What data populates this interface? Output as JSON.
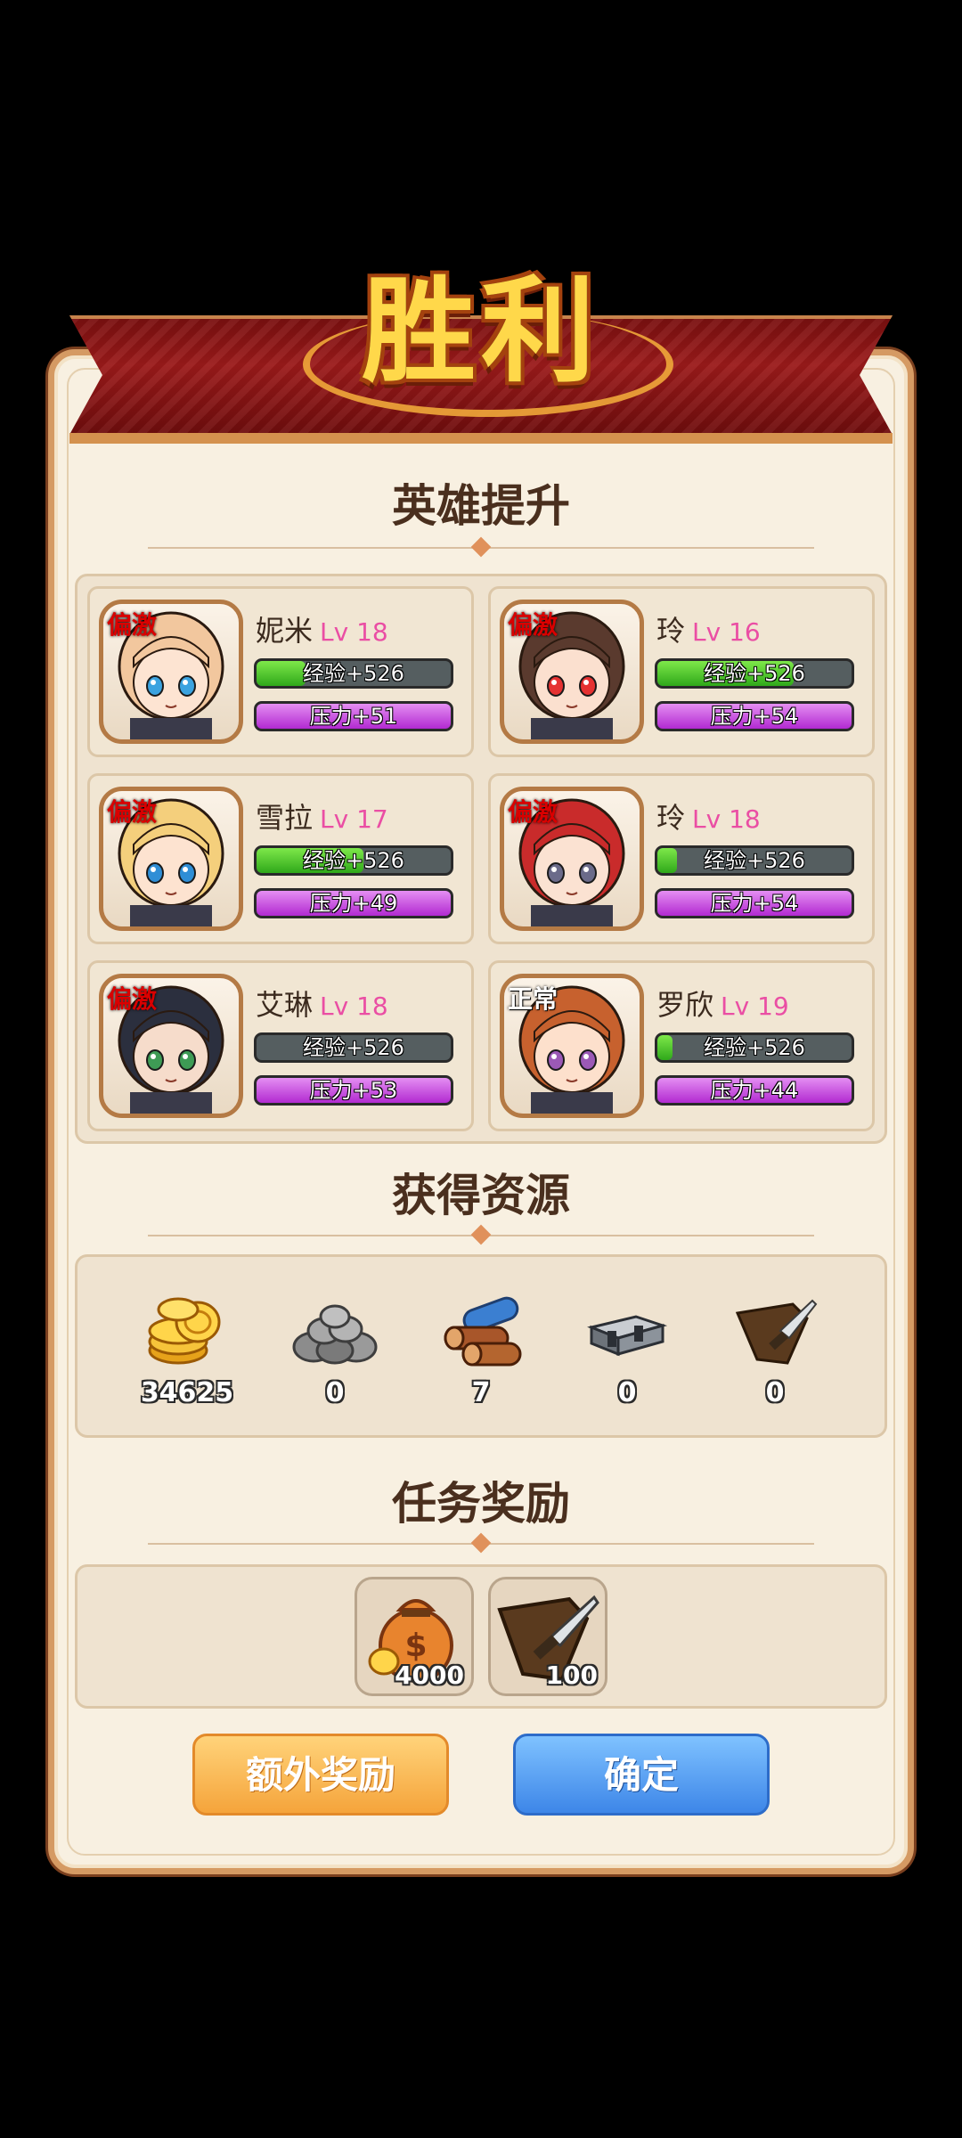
{
  "header": {
    "title": "胜利"
  },
  "heroes_section": {
    "title": "英雄提升"
  },
  "heroes": [
    {
      "tag": "偏激",
      "name": "妮米",
      "level": "Lv 18",
      "exp_text": "经验+526",
      "exp_fill": 0.25,
      "pressure_text": "压力+51",
      "hair": "#f2c79e",
      "skin": "#fde4d2",
      "accent": "#3ba3e0"
    },
    {
      "tag": "偏激",
      "name": "玲",
      "level": "Lv 16",
      "exp_text": "经验+526",
      "exp_fill": 0.7,
      "pressure_text": "压力+54",
      "hair": "#5a3a2e",
      "skin": "#fbe0cf",
      "accent": "#e53232"
    },
    {
      "tag": "偏激",
      "name": "雪拉",
      "level": "Lv 17",
      "exp_text": "经验+526",
      "exp_fill": 0.55,
      "pressure_text": "压力+49",
      "hair": "#f4cf7c",
      "skin": "#fde3d0",
      "accent": "#2f8ed6"
    },
    {
      "tag": "偏激",
      "name": "玲",
      "level": "Lv 18",
      "exp_text": "经验+526",
      "exp_fill": 0.1,
      "pressure_text": "压力+54",
      "hair": "#c92b2b",
      "skin": "#fbe2d2",
      "accent": "#6b6b8a"
    },
    {
      "tag": "偏激",
      "name": "艾琳",
      "level": "Lv 18",
      "exp_text": "经验+526",
      "exp_fill": 0.0,
      "pressure_text": "压力+53",
      "hair": "#2b2f3e",
      "skin": "#f6dccb",
      "accent": "#3e9b55"
    },
    {
      "tag": "正常",
      "name": "罗欣",
      "level": "Lv 19",
      "exp_text": "经验+526",
      "exp_fill": 0.08,
      "pressure_text": "压力+44",
      "hair": "#c7612e",
      "skin": "#fde0cc",
      "accent": "#9b59b6"
    }
  ],
  "resources_section": {
    "title": "获得资源"
  },
  "resources": [
    {
      "icon": "gold-coins-icon",
      "value": "34625"
    },
    {
      "icon": "stone-pile-icon",
      "value": "0"
    },
    {
      "icon": "wood-logs-icon",
      "value": "7"
    },
    {
      "icon": "iron-ingot-icon",
      "value": "0"
    },
    {
      "icon": "leather-knife-icon",
      "value": "0"
    }
  ],
  "quest_section": {
    "title": "任务奖励"
  },
  "quest_rewards": [
    {
      "icon": "money-bag-icon",
      "value": "4000"
    },
    {
      "icon": "leather-knife-icon",
      "value": "100"
    }
  ],
  "buttons": {
    "extra": "额外奖励",
    "confirm": "确定"
  }
}
